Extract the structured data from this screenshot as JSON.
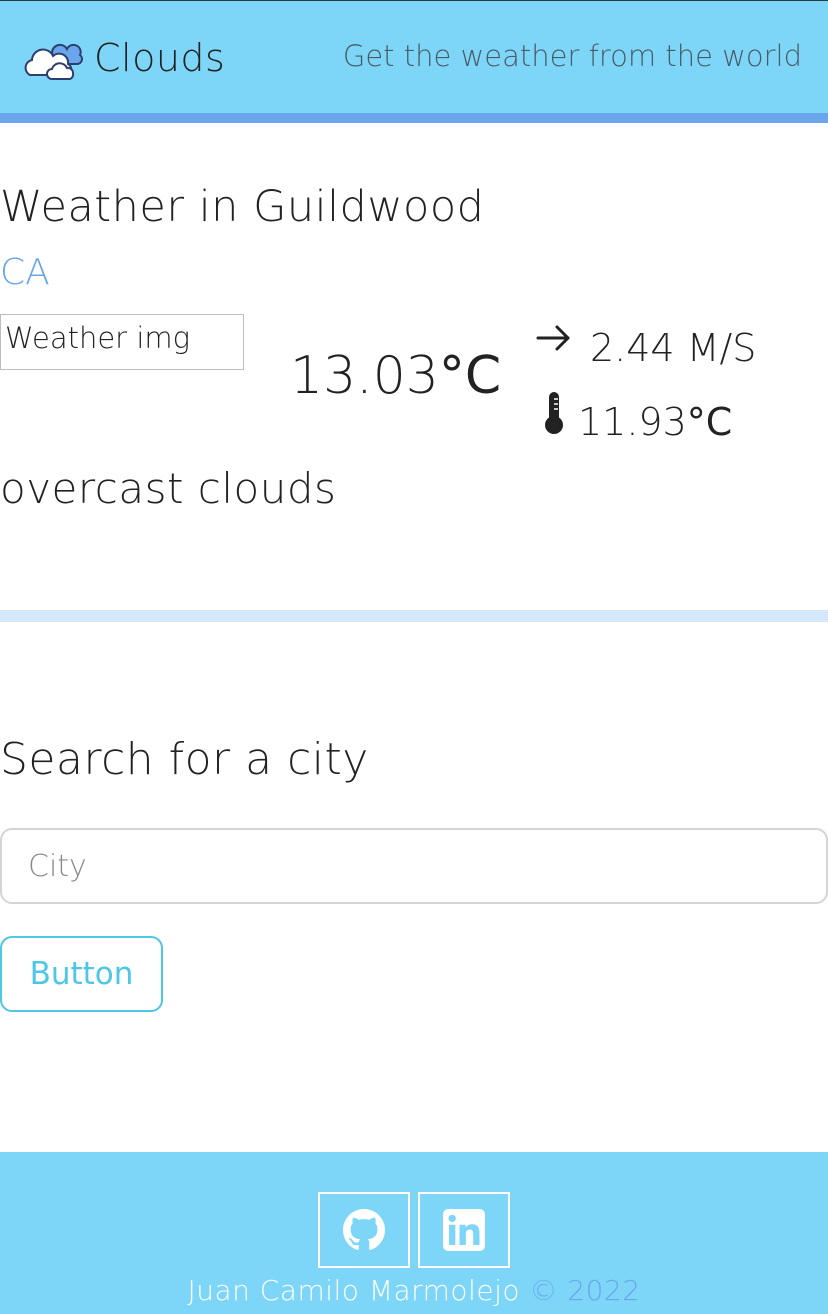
{
  "header": {
    "brand": "Clouds",
    "brand_icon": "cloud-icon",
    "tagline": "Get the weather from the world"
  },
  "weather": {
    "title": "Weather in Guildwood",
    "country": "CA",
    "image_alt": "Weather img",
    "temperature": "13.03",
    "temperature_unit": "°C",
    "wind_icon": "arrow-right-icon",
    "wind": "2.44 M/S",
    "feels_icon": "thermometer-icon",
    "feels_like": "11.93",
    "feels_like_unit": "°C",
    "description": "overcast clouds"
  },
  "search": {
    "title": "Search for a city",
    "placeholder": "City",
    "button_label": "Button"
  },
  "footer": {
    "github_icon": "github-icon",
    "linkedin_icon": "linkedin-icon",
    "author": "Juan Camilo Marmolejo",
    "copyright": "© 2022"
  },
  "colors": {
    "header_bg": "#7dd6f8",
    "header_bar": "#6aa6ec",
    "accent": "#4ec6e6",
    "country_text": "#6aa6ec",
    "divider": "#d5e8fb"
  }
}
